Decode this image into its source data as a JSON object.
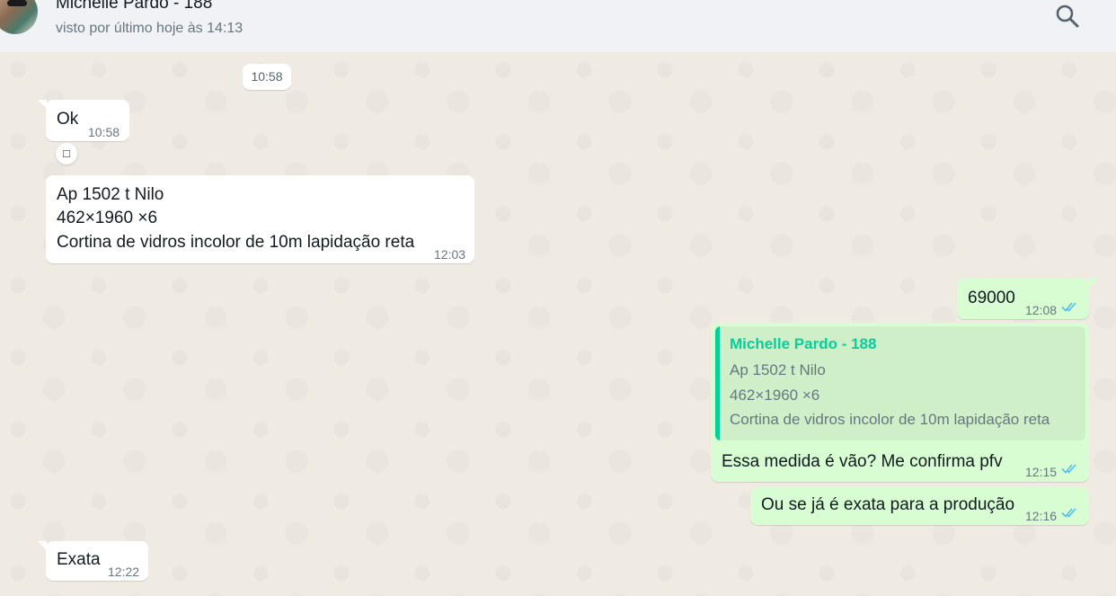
{
  "header": {
    "contact_name": "Michelle Pardo - 188",
    "status": "visto por último hoje às 14:13",
    "search_icon": "search-icon"
  },
  "date_chip": "10:58",
  "messages": [
    {
      "direction": "in",
      "text": "Ok",
      "time": "10:58"
    },
    {
      "direction": "in",
      "reaction": "□"
    },
    {
      "direction": "in",
      "lines": [
        "Ap 1502 t Nilo",
        "462×1960 ×6",
        "Cortina de vidros incolor de 10m lapidação reta"
      ],
      "time": "12:03"
    },
    {
      "direction": "out",
      "text": "69000",
      "time": "12:08",
      "status": "read"
    },
    {
      "direction": "out",
      "quote": {
        "author": "Michelle Pardo - 188",
        "lines": [
          "Ap 1502 t Nilo",
          "462×1960 ×6",
          "Cortina de vidros incolor de 10m lapidação reta"
        ]
      },
      "text": "Essa medida é vão? Me confirma pfv",
      "time": "12:15",
      "status": "read"
    },
    {
      "direction": "out",
      "text": "Ou se já é exata para a produção",
      "time": "12:16",
      "status": "read"
    },
    {
      "direction": "in",
      "text": "Exata",
      "time": "12:22"
    }
  ],
  "colors": {
    "chat_background": "#efeae2",
    "incoming_bubble": "#ffffff",
    "outgoing_bubble": "#d9fdd3",
    "quote_accent": "#06cf9c",
    "read_ticks": "#53bdeb"
  }
}
